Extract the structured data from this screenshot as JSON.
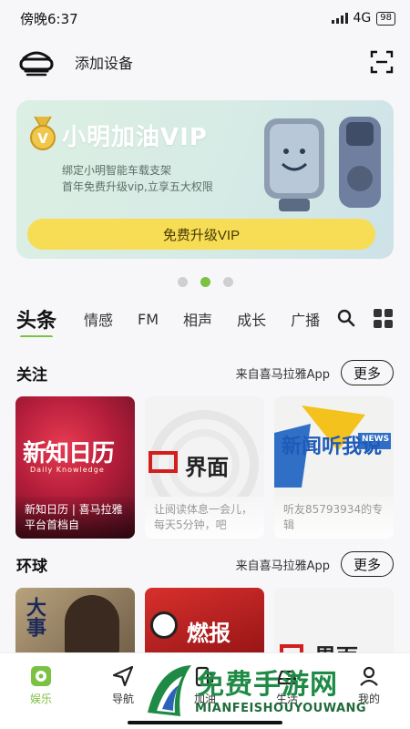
{
  "status_bar": {
    "time": "傍晚6:37",
    "network": "4G",
    "battery": "98"
  },
  "header": {
    "add_device_label": "添加设备"
  },
  "banner": {
    "title": "小明加油VIP",
    "line1": "绑定小明智能车载支架",
    "line2": "首年免费升级vip,立享五大权限",
    "button_label": "免费升级VIP",
    "badge_letter": "V"
  },
  "carousel": {
    "count": 3,
    "active_index": 1
  },
  "tabs": [
    {
      "label": "头条",
      "active": true
    },
    {
      "label": "情感"
    },
    {
      "label": "FM"
    },
    {
      "label": "相声"
    },
    {
      "label": "成长"
    },
    {
      "label": "广播"
    }
  ],
  "sections": [
    {
      "title": "关注",
      "source": "来自喜马拉雅App",
      "more_label": "更多",
      "cards": [
        {
          "art_text": "新知日历",
          "art_sub": "Daily Knowledge",
          "caption": "新知日历 | 喜马拉雅平台首档自"
        },
        {
          "art_text": "界面",
          "caption": "让阅读体息一会儿，每天5分钟，吧"
        },
        {
          "art_text": "新闻听我说",
          "art_badge": "NEWS",
          "caption": "听友85793934的专辑"
        }
      ]
    },
    {
      "title": "环球",
      "source": "来自喜马拉雅App",
      "more_label": "更多",
      "cards": [
        {
          "art_text": "大事"
        },
        {
          "art_text": "燃报"
        },
        {
          "art_text": "界面"
        }
      ]
    }
  ],
  "bottom_nav": [
    {
      "label": "娱乐",
      "icon": "music-box-icon",
      "active": true
    },
    {
      "label": "导航",
      "icon": "navigation-arrow-icon"
    },
    {
      "label": "加油",
      "icon": "fuel-pump-icon"
    },
    {
      "label": "生活",
      "icon": "car-icon"
    },
    {
      "label": "我的",
      "icon": "user-icon"
    }
  ],
  "watermark": {
    "title": "免费手游网",
    "subtitle": "MIANFEISHOUYOUWANG"
  },
  "colors": {
    "accent": "#7bc142",
    "vip_button": "#f6dd55",
    "banner_bg": "#d6ebe5",
    "watermark_green": "#1f8a45"
  }
}
